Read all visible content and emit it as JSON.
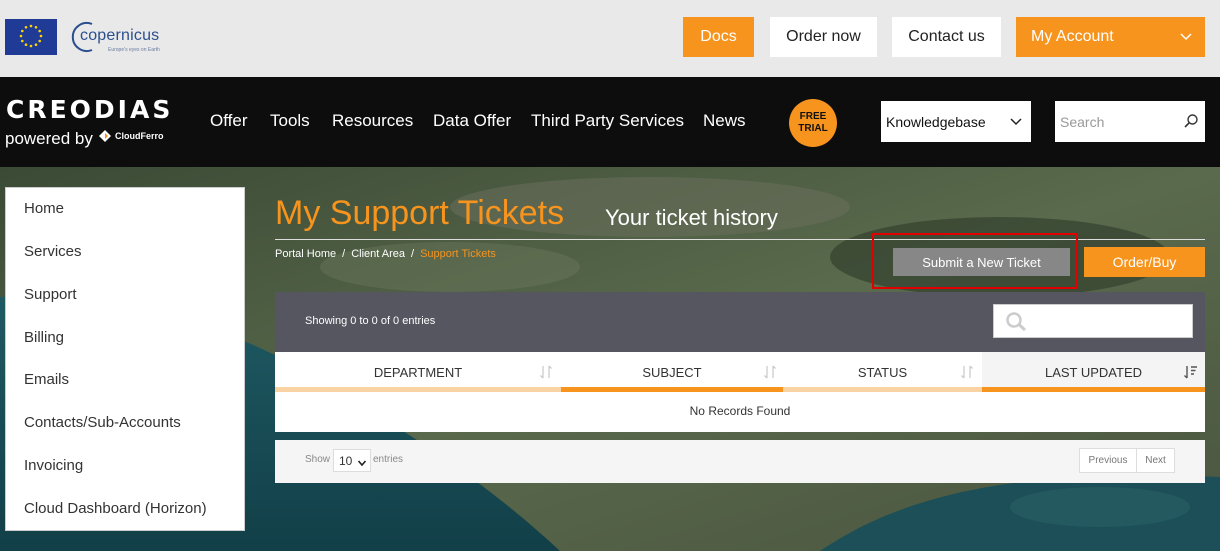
{
  "header": {
    "logo_name": "copernicus",
    "logo_tagline": "Europe's eyes on Earth",
    "buttons": {
      "docs": "Docs",
      "order_now": "Order now",
      "contact_us": "Contact us",
      "my_account": "My Account"
    },
    "colors": {
      "accent": "#f7941d",
      "nav_bg": "#0d0d0d"
    }
  },
  "nav": {
    "brand": "CREODIAS",
    "brand_sub": "powered by",
    "brand_partner": "CloudFerro",
    "items": [
      "Offer",
      "Tools",
      "Resources",
      "Data Offer",
      "Third Party Services",
      "News"
    ],
    "free_trial_line1": "FREE",
    "free_trial_line2": "TRIAL",
    "knowledgebase_select": "Knowledgebase",
    "search_placeholder": "Search"
  },
  "sidebar": {
    "items": [
      {
        "label": "Home"
      },
      {
        "label": "Services"
      },
      {
        "label": "Support"
      },
      {
        "label": "Billing"
      },
      {
        "label": "Emails"
      },
      {
        "label": "Contacts/Sub-Accounts"
      },
      {
        "label": "Invoicing"
      },
      {
        "label": "Cloud Dashboard (Horizon)"
      }
    ]
  },
  "main": {
    "title": "My Support Tickets",
    "subtitle": "Your ticket history",
    "breadcrumb": [
      "Portal Home",
      "Client Area",
      "Support Tickets"
    ],
    "submit_button": "Submit a New Ticket",
    "order_buy_button": "Order/Buy",
    "showing_text": "Showing 0 to 0 of 0 entries",
    "columns": [
      "DEPARTMENT",
      "SUBJECT",
      "STATUS",
      "LAST UPDATED"
    ],
    "no_records": "No Records Found",
    "show_label": "Show",
    "entries_value": "10",
    "entries_label": "entries",
    "previous": "Previous",
    "next": "Next"
  }
}
